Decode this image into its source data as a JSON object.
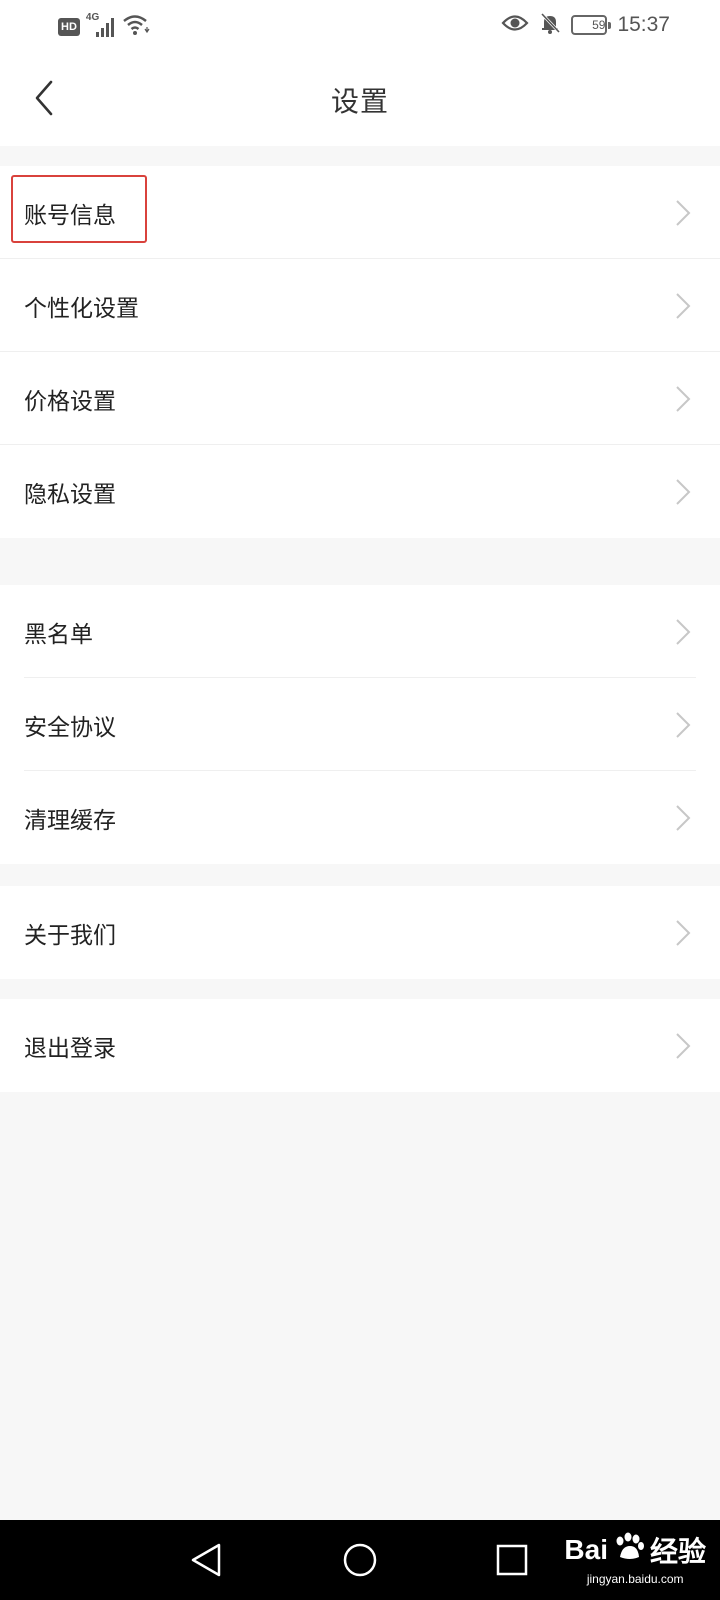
{
  "status_bar": {
    "hd_label": "HD",
    "network_label": "4G",
    "battery_level": "59",
    "time": "15:37",
    "icons": [
      "signal-icon",
      "wifi-icon",
      "eye-icon",
      "bell-off-icon",
      "battery-icon"
    ]
  },
  "header": {
    "back_icon": "chevron-left-icon",
    "title": "设置"
  },
  "settings": {
    "group1": [
      {
        "label": "账号信息",
        "highlighted": true
      },
      {
        "label": "个性化设置"
      },
      {
        "label": "价格设置"
      },
      {
        "label": "隐私设置"
      }
    ],
    "group2": [
      {
        "label": "黑名单"
      },
      {
        "label": "安全协议"
      },
      {
        "label": "清理缓存"
      }
    ],
    "group3": [
      {
        "label": "关于我们"
      }
    ],
    "group4": [
      {
        "label": "退出登录"
      }
    ]
  },
  "colors": {
    "highlight_border": "#d9423c",
    "background": "#f7f7f7",
    "row_background": "#ffffff"
  },
  "nav_bar": {
    "icons": [
      "nav-back-icon",
      "nav-home-icon",
      "nav-recents-icon"
    ]
  },
  "watermark": {
    "brand_prefix": "Bai",
    "brand_suffix": "经验",
    "url": "jingyan.baidu.com"
  }
}
